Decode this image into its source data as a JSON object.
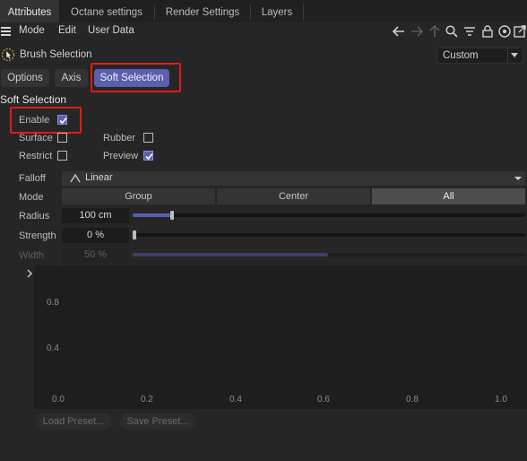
{
  "tabs": [
    {
      "label": "Attributes",
      "active": true
    },
    {
      "label": "Octane settings",
      "active": false
    },
    {
      "label": "Render Settings",
      "active": false
    },
    {
      "label": "Layers",
      "active": false
    }
  ],
  "menu": {
    "mode": "Mode",
    "edit": "Edit",
    "user_data": "User Data"
  },
  "toolbar_icons": [
    "arrow-left-icon",
    "arrow-right-icon",
    "arrow-up-icon",
    "search-icon",
    "filter-icon",
    "lock-icon",
    "target-icon",
    "new-window-icon"
  ],
  "object": {
    "title": "Brush Selection",
    "preset": "Custom"
  },
  "subtabs": [
    {
      "label": "Options",
      "active": false
    },
    {
      "label": "Axis",
      "active": false
    },
    {
      "label": "Soft Selection",
      "active": true
    }
  ],
  "section": {
    "title": "Soft Selection"
  },
  "checkboxes": {
    "enable": {
      "label": "Enable",
      "checked": true
    },
    "surface": {
      "label": "Surface",
      "checked": false
    },
    "rubber": {
      "label": "Rubber",
      "checked": false
    },
    "restrict": {
      "label": "Restrict",
      "checked": false
    },
    "preview": {
      "label": "Preview",
      "checked": true
    }
  },
  "falloff": {
    "label": "Falloff",
    "value": "Linear"
  },
  "mode": {
    "label": "Mode",
    "options": [
      "Group",
      "Center",
      "All"
    ],
    "selected": "All"
  },
  "radius": {
    "label": "Radius",
    "value": "100 cm"
  },
  "strength": {
    "label": "Strength",
    "value": "0 %"
  },
  "width": {
    "label": "Width",
    "value": "50 %"
  },
  "graph": {
    "y_ticks": [
      "0.8",
      "0.4"
    ],
    "x_ticks": [
      "0.0",
      "0.2",
      "0.4",
      "0.6",
      "0.8",
      "1.0"
    ]
  },
  "buttons": {
    "load_preset": "Load Preset...",
    "save_preset": "Save Preset..."
  },
  "colors": {
    "accent": "#5b5fb0",
    "highlight": "#e21a1a"
  }
}
